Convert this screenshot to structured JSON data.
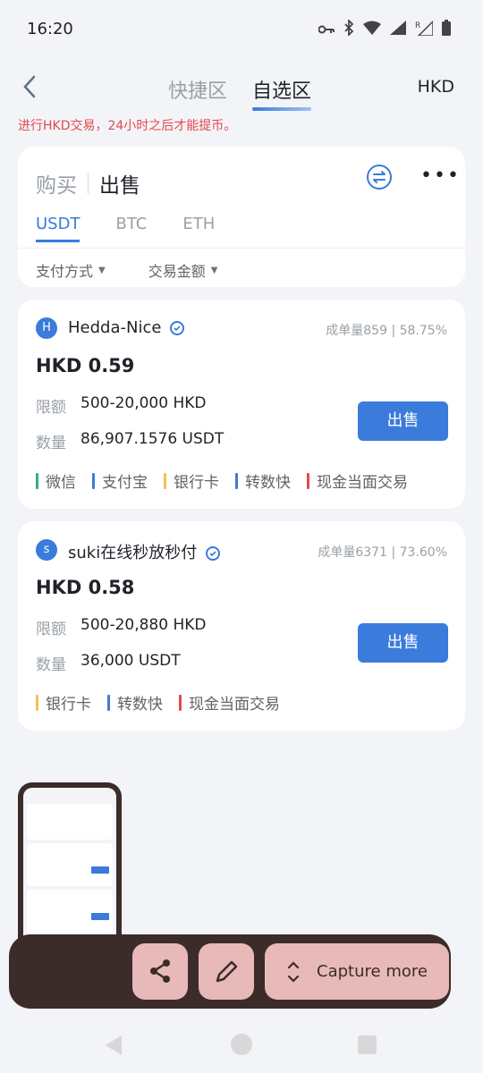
{
  "status_bar": {
    "time": "16:20"
  },
  "nav": {
    "tabs": [
      {
        "label": "快捷区"
      },
      {
        "label": "自选区"
      }
    ],
    "currency": "HKD"
  },
  "warning_text": "进行HKD交易，24小时之后才能提币。",
  "filter": {
    "modes": [
      {
        "label": "购买"
      },
      {
        "label": "出售"
      }
    ],
    "coins": [
      {
        "label": "USDT"
      },
      {
        "label": "BTC"
      },
      {
        "label": "ETH"
      }
    ],
    "dropdowns": [
      {
        "label": "支付方式"
      },
      {
        "label": "交易金额"
      }
    ]
  },
  "ads": [
    {
      "avatar_letter": "H",
      "name": "Hedda-Nice",
      "orders": "成单量859",
      "rate": "58.75%",
      "price": "HKD 0.59",
      "limit_label": "限额",
      "limit_value": "500-20,000 HKD",
      "qty_label": "数量",
      "qty_value": "86,907.1576 USDT",
      "button": "出售",
      "payments": [
        {
          "name": "微信",
          "color": "#2db47a"
        },
        {
          "name": "支付宝",
          "color": "#3a7bdc"
        },
        {
          "name": "银行卡",
          "color": "#f3c34a"
        },
        {
          "name": "转数快",
          "color": "#3a7bdc"
        },
        {
          "name": "现金当面交易",
          "color": "#e5484d"
        }
      ]
    },
    {
      "avatar_letter": "s",
      "name": "suki在线秒放秒付",
      "orders": "成单量6371",
      "rate": "73.60%",
      "price": "HKD 0.58",
      "limit_label": "限额",
      "limit_value": "500-20,880 HKD",
      "qty_label": "数量",
      "qty_value": "36,000 USDT",
      "button": "出售",
      "payments": [
        {
          "name": "银行卡",
          "color": "#f3c34a"
        },
        {
          "name": "转数快",
          "color": "#3a7bdc"
        },
        {
          "name": "现金当面交易",
          "color": "#e5484d"
        }
      ]
    }
  ],
  "capture_toolbar": {
    "capture_more": "Capture more"
  },
  "colors": {
    "accent": "#3a7bdc",
    "warning": "#e5484d",
    "toolbar_bg": "#3b2c2a",
    "toolbar_btn": "#e8b9b9"
  }
}
